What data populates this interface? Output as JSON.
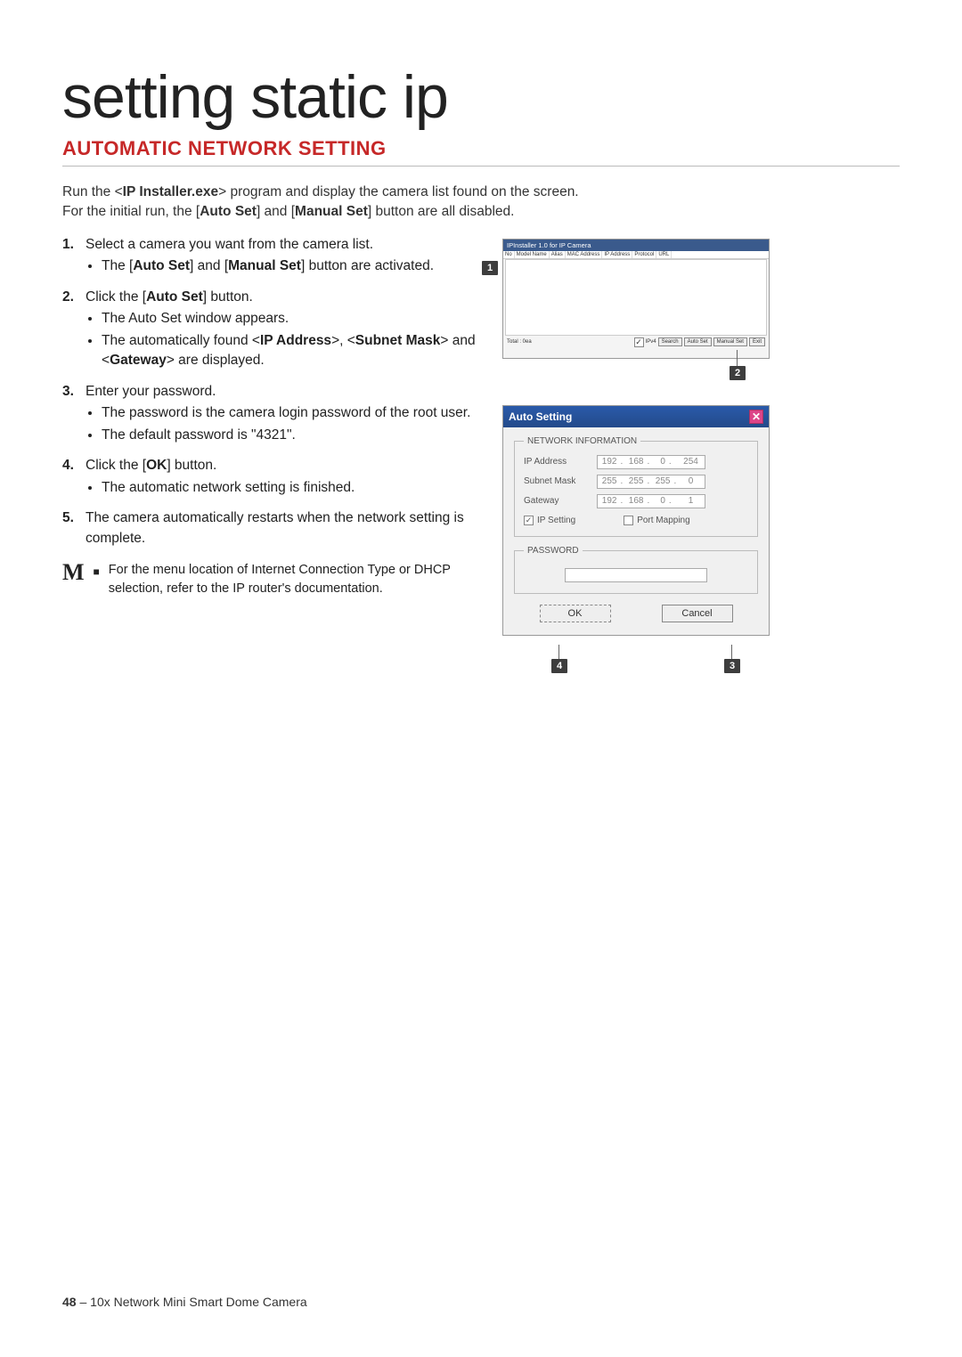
{
  "title": "setting static ip",
  "subtitle": "AUTOMATIC NETWORK SETTING",
  "intro_line1_a": "Run the <",
  "intro_line1_b": "IP Installer.exe",
  "intro_line1_c": "> program and display the camera list found on the screen.",
  "intro_line2_a": "For the initial run, the [",
  "intro_line2_b": "Auto Set",
  "intro_line2_c": "] and [",
  "intro_line2_d": "Manual Set",
  "intro_line2_e": "] button are all disabled.",
  "steps": {
    "s1": "Select a camera you want from the camera list.",
    "s1b_a": "The [",
    "s1b_b": "Auto Set",
    "s1b_c": "] and [",
    "s1b_d": "Manual Set",
    "s1b_e": "] button are activated.",
    "s2_a": "Click the [",
    "s2_b": "Auto Set",
    "s2_c": "] button.",
    "s2b1": "The Auto Set window appears.",
    "s2b2_a": "The automatically found <",
    "s2b2_b": "IP Address",
    "s2b2_c": ">, <",
    "s2b2_d": "Subnet Mask",
    "s2b2_e": "> and <",
    "s2b2_f": "Gateway",
    "s2b2_g": "> are displayed.",
    "s3": "Enter your password.",
    "s3b1": "The password is the camera login password of the root user.",
    "s3b2": "The default password is \"4321\".",
    "s4_a": "Click the [",
    "s4_b": "OK",
    "s4_c": "] button.",
    "s4b1": "The automatic network setting is finished.",
    "s5": "The camera automatically restarts when the network setting is complete."
  },
  "note_m": "M",
  "note_bullet": "■",
  "note_text": "For the menu location of Internet Connection Type or DHCP selection, refer to the IP router's documentation.",
  "ss1": {
    "title": "IPInstaller 1.0 for IP Camera",
    "cols": [
      "No",
      "Model Name",
      "Alias",
      "MAC Address",
      "IP Address",
      "Protocol",
      "URL"
    ],
    "footer_left": "Total : 0ea",
    "ipv4": "IPv4",
    "search": "Search",
    "autoset": "Auto Set",
    "manualset": "Manual Set",
    "exit": "Exit"
  },
  "ss2": {
    "title": "Auto Setting",
    "close": "✕",
    "legend1": "NETWORK INFORMATION",
    "ip_label": "IP Address",
    "ip": [
      "192",
      "168",
      "0",
      "254"
    ],
    "subnet_label": "Subnet Mask",
    "subnet": [
      "255",
      "255",
      "255",
      "0"
    ],
    "gw_label": "Gateway",
    "gw": [
      "192",
      "168",
      "0",
      "1"
    ],
    "ip_setting": "IP Setting",
    "port_mapping": "Port Mapping",
    "legend2": "PASSWORD",
    "ok": "OK",
    "cancel": "Cancel"
  },
  "callouts": {
    "c1": "1",
    "c2": "2",
    "c3": "3",
    "c4": "4"
  },
  "footer_page": "48",
  "footer_sep": " – ",
  "footer_text": "10x Network Mini Smart Dome Camera"
}
